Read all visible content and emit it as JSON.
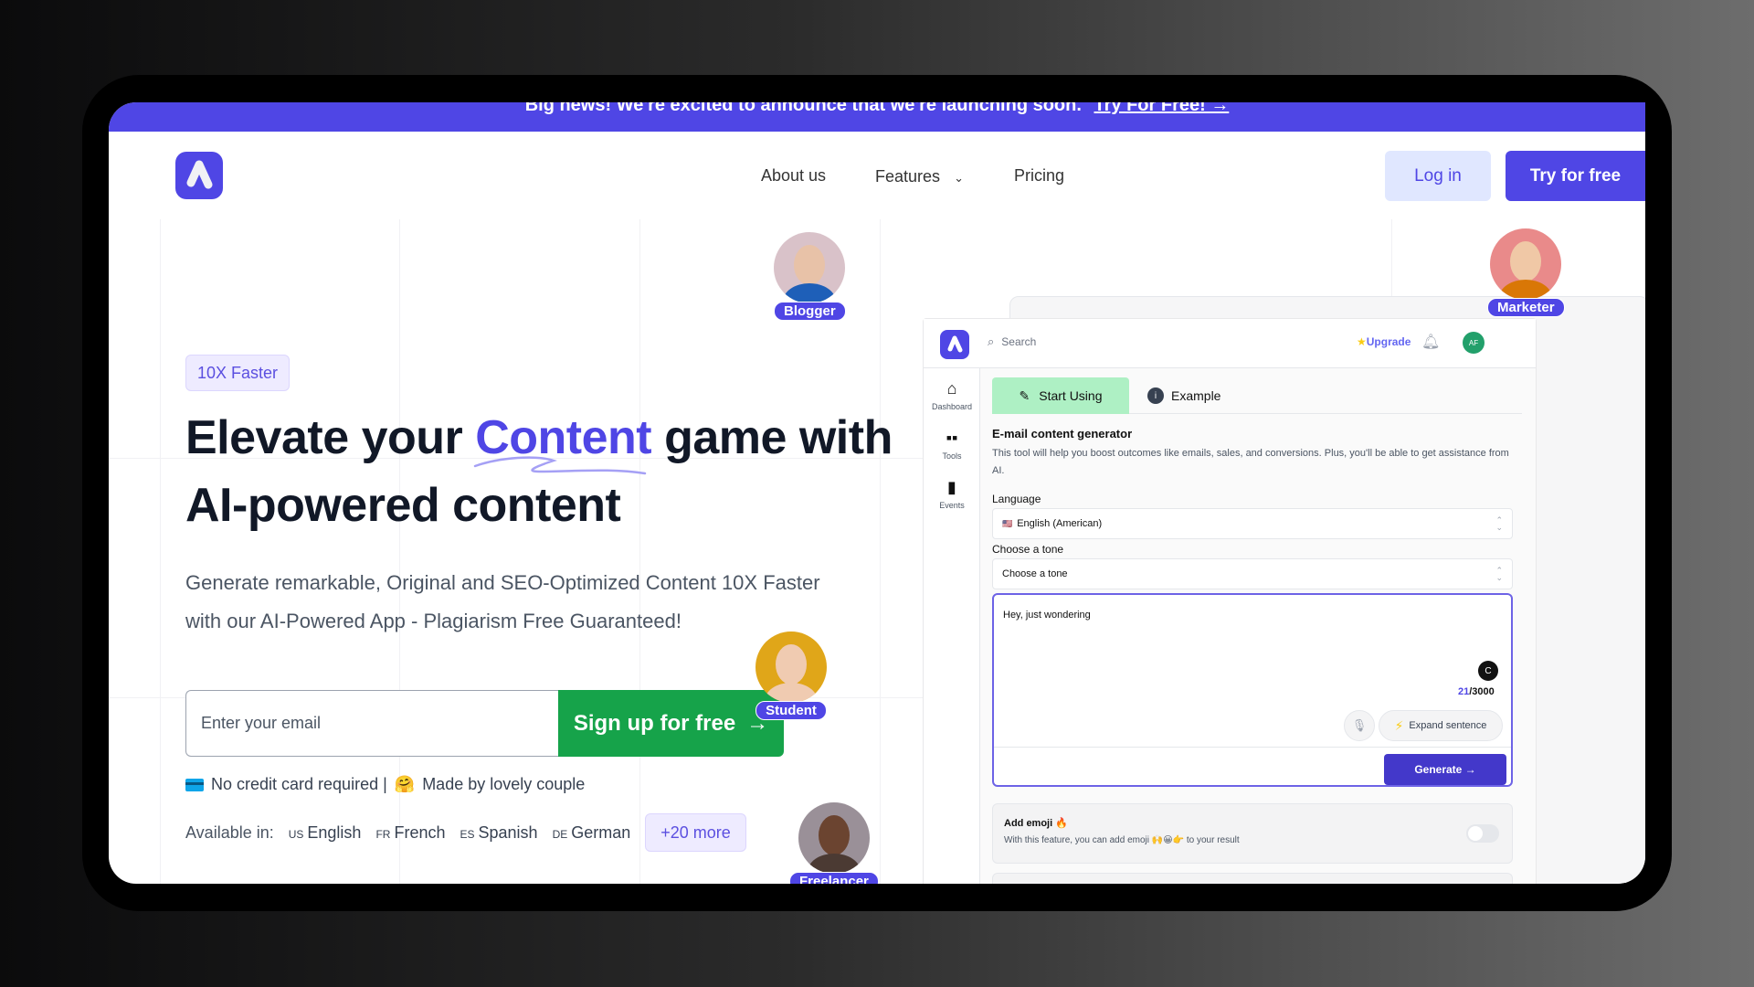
{
  "banner": {
    "text": "Big news! We're excited to announce that we're launching soon.",
    "cta": "Try For Free! →"
  },
  "nav": {
    "logo": "app-logo",
    "links": [
      "About us",
      "Features",
      "Pricing"
    ],
    "login": "Log in",
    "try_free": "Try for free"
  },
  "hero": {
    "badge": "10X Faster",
    "title_before": "Elevate your ",
    "title_accent": "Content",
    "title_after": " game with",
    "title_line2": "AI-powered content",
    "subtitle_line1": "Generate remarkable, Original and SEO-Optimized Content 10X Faster",
    "subtitle_line2": "with our AI-Powered App - Plagiarism Free Guaranteed!",
    "email_placeholder": "Enter your email",
    "signup_label": "Sign up for free",
    "signup_arrow": "→",
    "note_no_card": "No credit card required |",
    "note_made_by": "Made by lovely couple",
    "note_emoji": "🤗",
    "available_label": "Available in:",
    "languages": [
      {
        "code": "US",
        "name": "English"
      },
      {
        "code": "FR",
        "name": "French"
      },
      {
        "code": "ES",
        "name": "Spanish"
      },
      {
        "code": "DE",
        "name": "German"
      }
    ],
    "more_languages": "+20 more"
  },
  "personas": [
    "Blogger",
    "Marketer",
    "Student",
    "Freelancer"
  ],
  "mockup": {
    "search_placeholder": "Search",
    "upgrade": "Upgrade",
    "avatar_initials": "AF",
    "sidebar": [
      "Dashboard",
      "Tools",
      "Events"
    ],
    "tabs": {
      "active": "Start Using",
      "other": "Example"
    },
    "tool_title": "E-mail content generator",
    "tool_desc": "This tool will help you boost outcomes like emails, sales, and conversions. Plus, you'll be able to get assistance from AI.",
    "language_label": "Language",
    "language_value": "English (American)",
    "tone_label": "Choose a tone",
    "tone_value": "Choose a tone",
    "textarea_value": "Hey, just wondering",
    "char_count_current": "21",
    "char_count_max": "/3000",
    "expand_label": "Expand sentence",
    "generate_label": "Generate →",
    "emoji_title": "Add emoji 🔥",
    "emoji_desc": "With this feature, you can add emoji 🙌😀👉 to your result",
    "emoji_toggle_on": false
  },
  "colors": {
    "brand": "#4F46E5",
    "cta_green": "#16A34A",
    "badge_bg": "#EEEBFF",
    "tab_active": "#AEF0C4"
  }
}
